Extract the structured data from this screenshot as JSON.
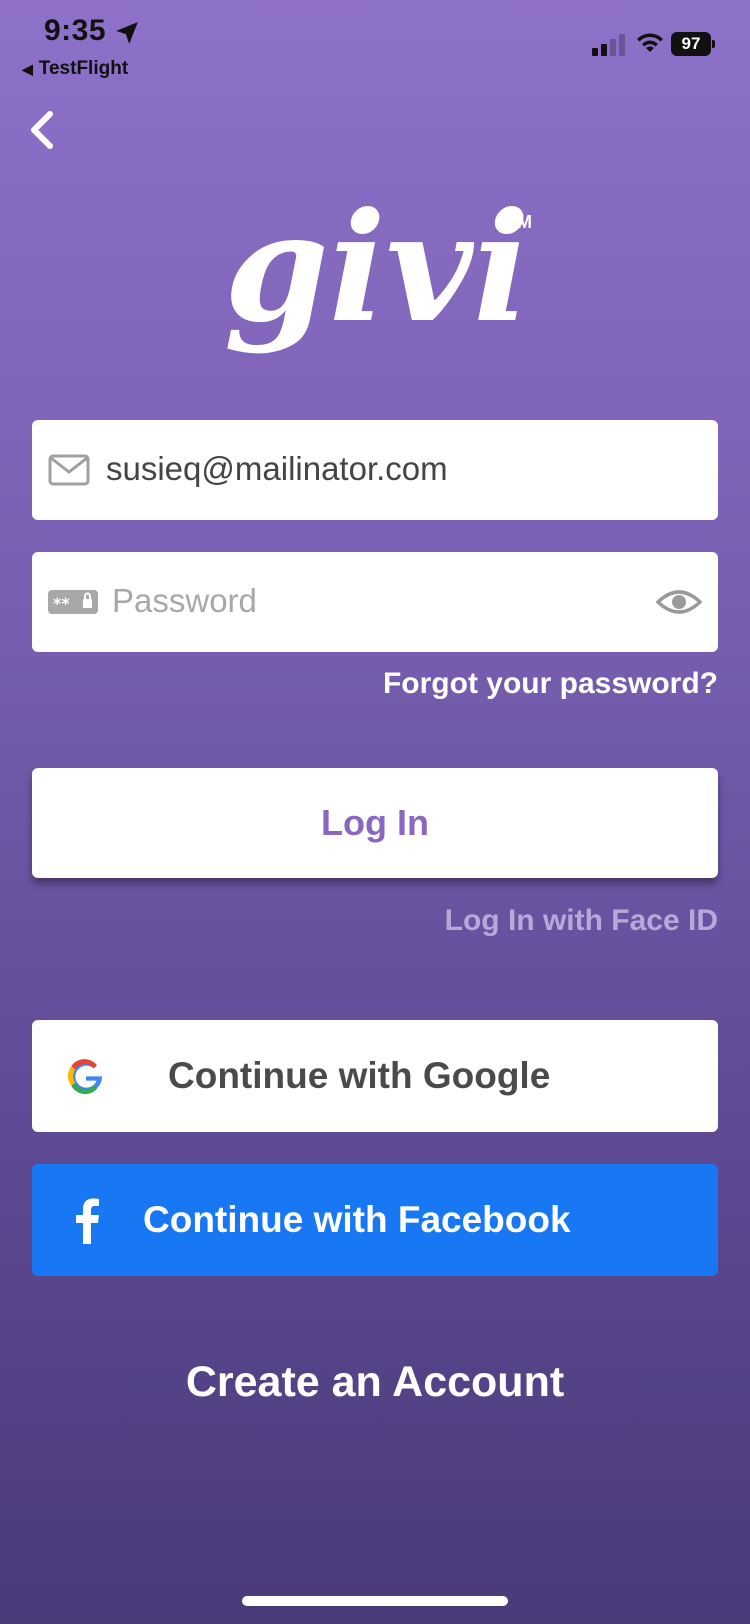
{
  "status_bar": {
    "time": "9:35",
    "back_app_label": "TestFlight",
    "battery": "97"
  },
  "logo": {
    "text": "givi",
    "trademark": "TM"
  },
  "email_field": {
    "value": "susieq@mailinator.com",
    "icon": "mail-icon"
  },
  "password_field": {
    "placeholder": "Password",
    "icon": "password-icon",
    "toggle_icon": "eye-icon"
  },
  "forgot_password": "Forgot your password?",
  "login_button": "Log In",
  "face_id": "Log In with Face ID",
  "google_button": "Continue with Google",
  "facebook_button": "Continue with Facebook",
  "create_account": "Create an Account",
  "colors": {
    "background_top": "#8e71c9",
    "background_bottom": "#4a3a78",
    "accent": "#8a67c2",
    "facebook": "#1877f2"
  }
}
